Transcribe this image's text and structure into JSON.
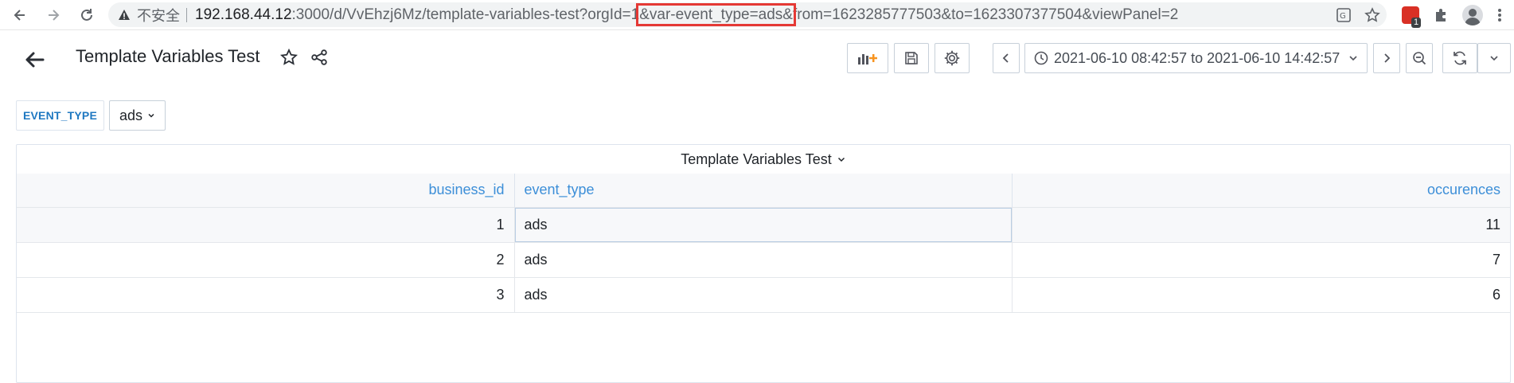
{
  "browser": {
    "insecure_label": "不安全",
    "url_host": "192.168.44.12",
    "url_path_before": ":3000/d/VvEhzj6Mz/template-variables-test?orgId=1",
    "url_highlight": "&var-event_type=ads&",
    "url_path_after": "from=1623285777503&to=1623307377504&viewPanel=2",
    "extension_badge": "1"
  },
  "dashboard": {
    "title": "Template Variables Test",
    "time_range": "2021-06-10 08:42:57 to 2021-06-10 14:42:57"
  },
  "variables": {
    "label": "EVENT_TYPE",
    "value": "ads"
  },
  "panel": {
    "title": "Template Variables Test",
    "columns": [
      "business_id",
      "event_type",
      "occurences"
    ],
    "rows": [
      [
        "1",
        "ads",
        "11"
      ],
      [
        "2",
        "ads",
        "7"
      ],
      [
        "3",
        "ads",
        "6"
      ]
    ]
  },
  "colors": {
    "accent_blue": "#1f78c1",
    "header_text_blue": "#3d8fd8",
    "highlight_red": "#e53935"
  }
}
